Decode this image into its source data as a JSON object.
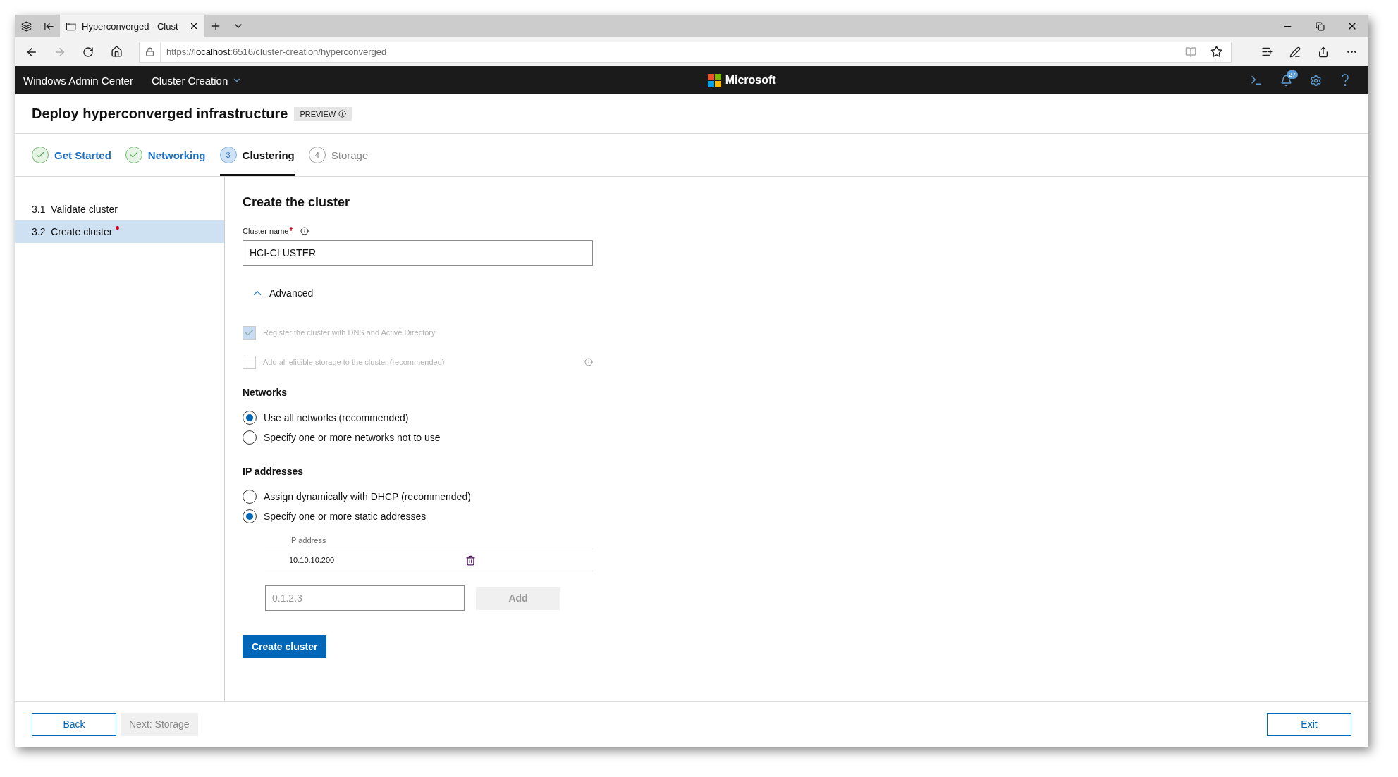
{
  "browser": {
    "tabs": [
      {
        "title": "Hyperconverged - Clust",
        "selected": true
      }
    ],
    "url": "https://**localhost**:6516/cluster-creation/hyperconverged"
  },
  "app_header": {
    "brand": "Windows Admin Center",
    "menu": "Cluster Creation",
    "logo_text": "Microsoft",
    "notification_count": "27"
  },
  "page": {
    "title": "Deploy hyperconverged infrastructure",
    "badge": "PREVIEW"
  },
  "steps": [
    {
      "kind": "done",
      "label": "Get Started",
      "selected": false
    },
    {
      "kind": "done",
      "label": "Networking",
      "selected": false
    },
    {
      "kind": "current",
      "number": "3",
      "label": "Clustering",
      "selected": true
    },
    {
      "kind": "todo",
      "number": "4",
      "label": "Storage",
      "selected": false
    }
  ],
  "sidebar": {
    "items": [
      {
        "number": "3.1",
        "label": "Validate cluster",
        "selected": false,
        "attention": false
      },
      {
        "number": "3.2",
        "label": "Create cluster",
        "selected": true,
        "attention": true
      }
    ]
  },
  "form": {
    "heading": "Create the cluster",
    "cluster_name": {
      "label": "Cluster name",
      "required": true,
      "value": "HCI-CLUSTER"
    },
    "advanced": {
      "label": "Advanced",
      "expanded": true
    },
    "checkboxes": [
      {
        "label": "Register the cluster with DNS and Active Directory",
        "checked": true,
        "disabled": true,
        "info": false
      },
      {
        "label": "Add all eligible storage to the cluster (recommended)",
        "checked": false,
        "disabled": true,
        "info": true
      }
    ],
    "networks": {
      "heading": "Networks",
      "options": [
        {
          "label": "Use all networks (recommended)",
          "selected": true
        },
        {
          "label": "Specify one or more networks not to use",
          "selected": false
        }
      ]
    },
    "ip_addresses": {
      "heading": "IP addresses",
      "options": [
        {
          "label": "Assign dynamically with DHCP (recommended)",
          "selected": false
        },
        {
          "label": "Specify one or more static addresses",
          "selected": true
        }
      ],
      "table": {
        "column": "IP address",
        "rows": [
          {
            "address": "10.10.10.200"
          }
        ]
      },
      "new_address": {
        "placeholder": "0.1.2.3"
      },
      "add_button": {
        "label": "Add",
        "disabled": true
      }
    },
    "create_button": "Create cluster"
  },
  "footer": {
    "back": "Back",
    "next": {
      "label": "Next: Storage",
      "disabled": true
    },
    "exit": "Exit"
  }
}
